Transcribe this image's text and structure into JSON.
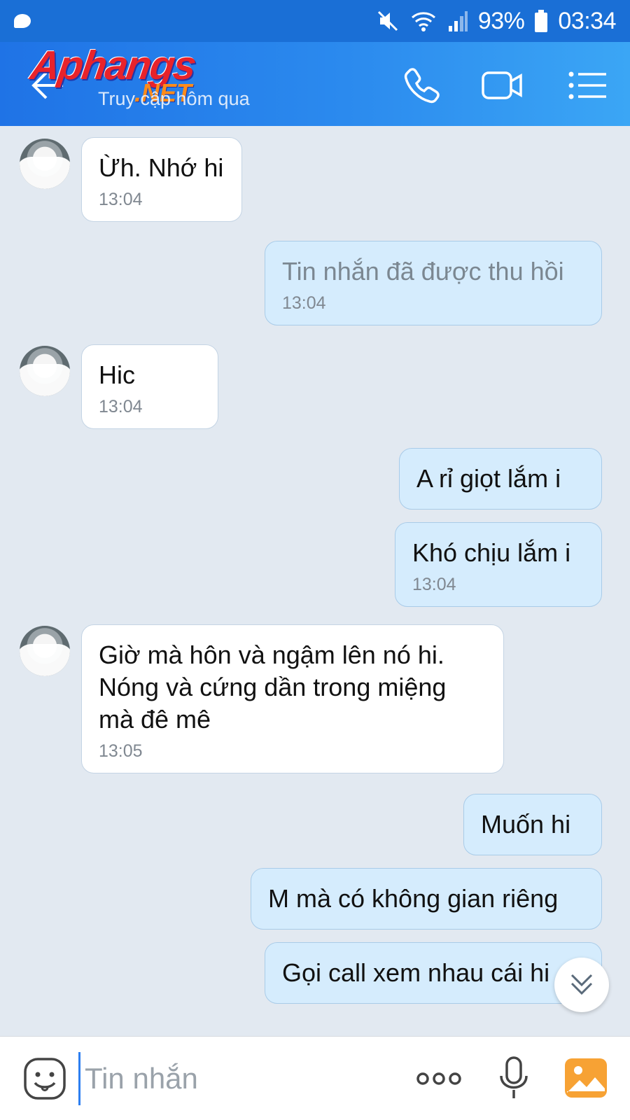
{
  "status_bar": {
    "battery": "93%",
    "time": "03:34"
  },
  "header": {
    "watermark_logo": "Aphangs",
    "watermark_net": ".NET",
    "subtitle": "Truy cập hôm qua"
  },
  "messages": [
    {
      "direction": "in",
      "text": "Ừh. Nhớ hi",
      "time": "13:04"
    },
    {
      "direction": "out",
      "text": "Tin nhắn đã được thu hồi",
      "time": "13:04",
      "recalled": true
    },
    {
      "direction": "in",
      "text": "Hic",
      "time": "13:04"
    },
    {
      "direction": "out",
      "text": "A rỉ giọt lắm i",
      "time": ""
    },
    {
      "direction": "out",
      "text": "Khó chịu lắm i",
      "time": "13:04"
    },
    {
      "direction": "in",
      "text_lines": [
        "Giờ mà hôn và ngậm lên nó hi.",
        "Nóng và cứng dần trong miệng",
        "mà đê mê"
      ],
      "time": "13:05"
    },
    {
      "direction": "out",
      "text": "Muốn hi",
      "time": ""
    },
    {
      "direction": "out",
      "text": "M mà có không gian riêng",
      "time": ""
    },
    {
      "direction": "out",
      "text": "Gọi call xem nhau cái hi",
      "time": ""
    }
  ],
  "composer": {
    "placeholder": "Tin nhắn"
  },
  "icons": {
    "status": [
      "mute-icon",
      "wifi-icon",
      "signal-icon",
      "battery-icon"
    ],
    "header": [
      "back-arrow-icon",
      "phone-icon",
      "video-call-icon",
      "menu-icon"
    ],
    "composer": [
      "emoji-icon",
      "more-icon",
      "microphone-icon",
      "photo-icon"
    ],
    "scroll": "chevron-double-down-icon"
  },
  "colors": {
    "header_blue": "#1f73e6",
    "outgoing_bubble": "#d5ecfd",
    "incoming_bubble": "#ffffff",
    "chat_background": "#e2e9f1",
    "photo_button": "#f7a234"
  }
}
